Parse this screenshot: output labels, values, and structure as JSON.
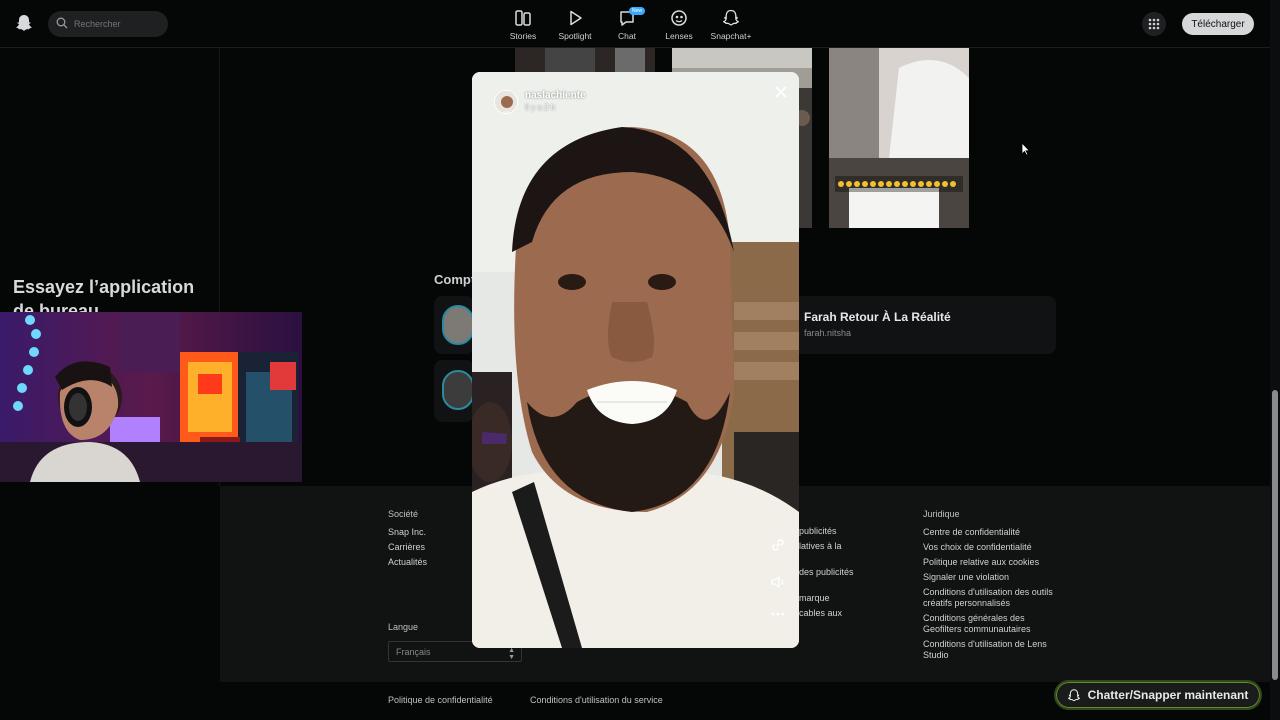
{
  "topbar": {
    "search_placeholder": "Rechercher",
    "nav": [
      {
        "label": "Stories",
        "icon": "stories-icon"
      },
      {
        "label": "Spotlight",
        "icon": "play-icon"
      },
      {
        "label": "Chat",
        "icon": "chat-icon",
        "badge": "New"
      },
      {
        "label": "Lenses",
        "icon": "lens-icon"
      },
      {
        "label": "Snapchat+",
        "icon": "ghost-icon"
      }
    ],
    "download_label": "Télécharger"
  },
  "sidebar": {
    "try_app": "Essayez l’application de bureau"
  },
  "main": {
    "section_label": "Compt",
    "card": {
      "title": "Farah Retour À La Réalité",
      "subtitle": "farah.nitsha"
    }
  },
  "story": {
    "username": "naslachiente",
    "time": "Il y a 2 h"
  },
  "footer": {
    "societe": {
      "heading": "Société",
      "links": [
        "Snap Inc.",
        "Carrières",
        "Actualités"
      ]
    },
    "middle": {
      "links": [
        "publicités",
        "latives à la",
        "des publicités",
        "marque",
        "cables aux"
      ]
    },
    "juridique": {
      "heading": "Juridique",
      "links": [
        "Centre de confidentialité",
        "Vos choix de confidentialité",
        "Politique relative aux cookies",
        "Signaler une violation",
        "Conditions d'utilisation des outils créatifs personnalisés",
        "Conditions générales des Geofilters communautaires",
        "Conditions d'utilisation de Lens Studio"
      ]
    },
    "language_label": "Langue",
    "language_value": "Français",
    "bottom_links": [
      "Politique de confidentialité",
      "Conditions d'utilisation du service"
    ]
  },
  "chat_now_label": "Chatter/Snapper maintenant",
  "colors": {
    "background": "#050606",
    "footer": "#111212",
    "accent_green": "#6a8a2a",
    "badge_blue": "#3aa8ff"
  }
}
